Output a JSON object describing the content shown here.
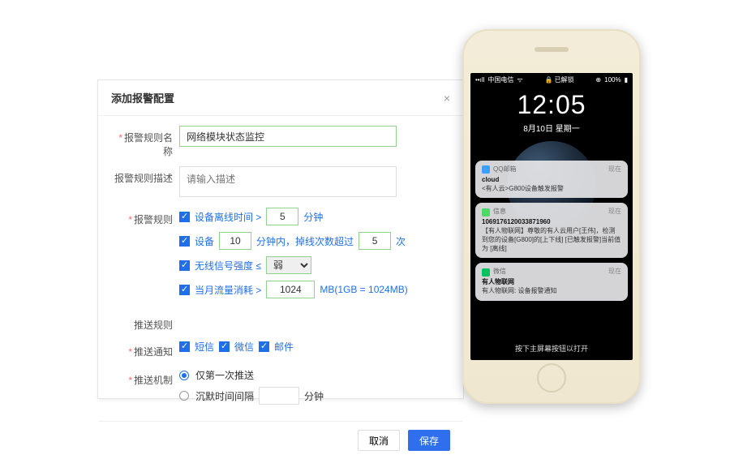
{
  "modal": {
    "title": "添加报警配置",
    "labels": {
      "rule_name": "报警规则名称",
      "rule_desc": "报警规则描述",
      "alarm_rules": "报警规则",
      "push_rules": "推送规则",
      "push_notify": "推送通知",
      "push_mech": "推送机制"
    },
    "name_value": "网络模块状态监控",
    "desc_placeholder": "请输入描述",
    "rule1": {
      "label": "设备离线时间 >",
      "value": "5",
      "unit": "分钟"
    },
    "rule2": {
      "label": "设备",
      "value": "10",
      "mid": "分钟内，掉线次数超过",
      "value2": "5",
      "unit": "次"
    },
    "rule3": {
      "label": "无线信号强度 ≤",
      "option": "弱"
    },
    "rule4": {
      "label": "当月流量消耗 >",
      "value": "1024",
      "unit": "MB(1GB = 1024MB)"
    },
    "notify": {
      "sms": "短信",
      "wechat": "微信",
      "email": "邮件"
    },
    "mech": {
      "once": "仅第一次推送",
      "silent": "沉默时间间隔",
      "silent_unit": "分钟"
    },
    "buttons": {
      "cancel": "取消",
      "save": "保存"
    }
  },
  "phone": {
    "carrier": "中国电信",
    "wifi": "令",
    "lock": "已解锁",
    "battery": "100%",
    "time": "12:05",
    "date": "8月10日 星期一",
    "notifications": [
      {
        "app": "QQ邮箱",
        "time_label": "现在",
        "title": "cloud",
        "body": "<有人云>G800设备触发报警"
      },
      {
        "app": "信息",
        "time_label": "现在",
        "title": "1069176120033871960",
        "body": "【有人物联网】尊敬的有人云用户[王伟]，检测到您的设备[G800]的[上下线] [已触发报警]当前值为 [离线]"
      },
      {
        "app": "微信",
        "time_label": "现在",
        "title": "有人物联网",
        "body": "有人物联网: 设备报警通知"
      }
    ],
    "hint": "按下主屏幕按钮以打开"
  }
}
